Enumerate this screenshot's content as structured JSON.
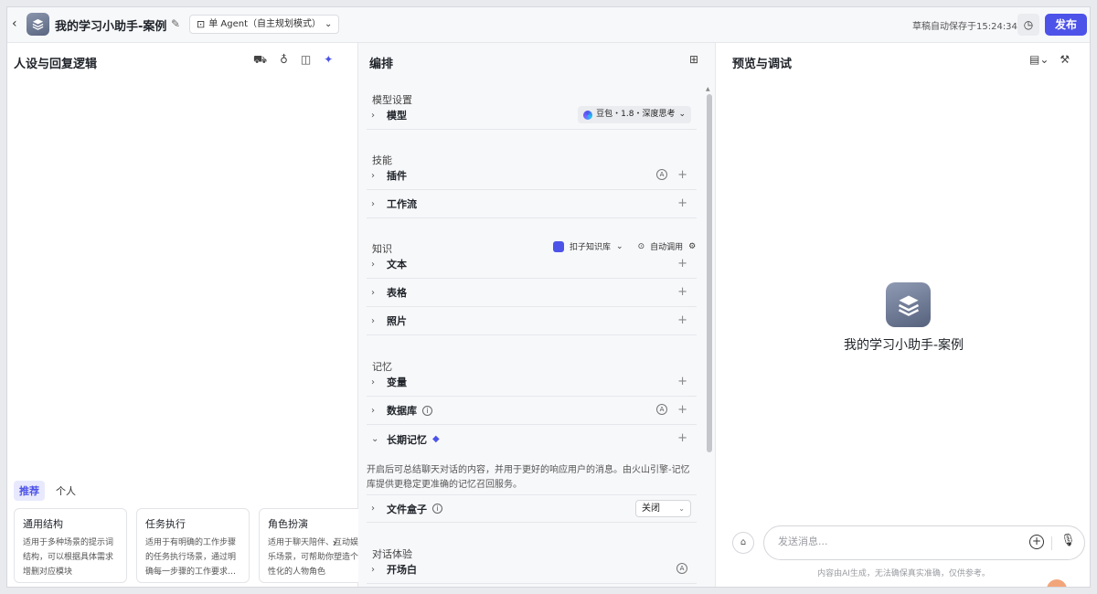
{
  "header": {
    "title": "我的学习小助手-案例",
    "agent_mode": "单 Agent（自主规划模式）",
    "save_status": "草稿自动保存于15:24:34",
    "publish_label": "发布"
  },
  "left": {
    "title": "人设与回复逻辑",
    "tabs": [
      "推荐",
      "个人"
    ],
    "cards": [
      {
        "title": "通用结构",
        "desc": "适用于多种场景的提示词结构，可以根据具体需求增删对应模块"
      },
      {
        "title": "任务执行",
        "desc": "适用于有明确的工作步骤的任务执行场景，通过明确每一步骤的工作要求…"
      },
      {
        "title": "角色扮演",
        "desc": "适用于聊天陪伴、互动娱乐场景，可帮助你塑造个性化的人物角色"
      }
    ]
  },
  "middle": {
    "title": "编排",
    "model_section": "模型设置",
    "model_label": "模型",
    "model_value": "豆包・1.8・深度思考",
    "skills_section": "技能",
    "plugin_label": "插件",
    "workflow_label": "工作流",
    "knowledge_section": "知识",
    "kb_source": "扣子知识库",
    "kb_auto": "自动调用",
    "text_label": "文本",
    "table_label": "表格",
    "photo_label": "照片",
    "memory_section": "记忆",
    "variable_label": "变量",
    "database_label": "数据库",
    "long_memory_label": "长期记忆",
    "long_memory_desc": "开启后可总结聊天对话的内容，并用于更好的响应用户的消息。由火山引擎-记忆库提供更稳定更准确的记忆召回服务。",
    "filebox_label": "文件盒子",
    "filebox_value": "关闭",
    "dialog_section": "对话体验",
    "opening_label": "开场白"
  },
  "right": {
    "title": "预览与调试",
    "bot_name": "我的学习小助手-案例",
    "input_placeholder": "发送消息...",
    "disclaimer": "内容由AI生成，无法确保真实准确，仅供参考。"
  }
}
